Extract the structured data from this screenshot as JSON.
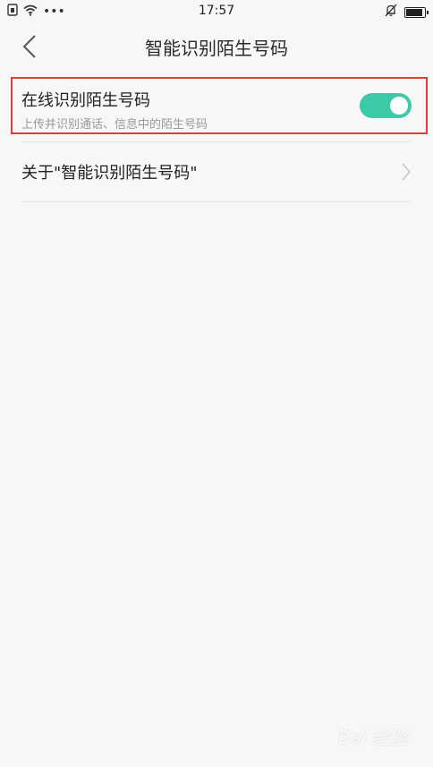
{
  "status_bar": {
    "time": "17:57",
    "left_icons": [
      "sim-icon",
      "wifi-icon",
      "more-dots-icon"
    ],
    "right_icons": [
      "mute-bell-icon",
      "battery-icon"
    ],
    "dots": "•••"
  },
  "nav": {
    "title": "智能识别陌生号码",
    "back_icon": "chevron-left-icon"
  },
  "settings": {
    "online_identify": {
      "title": "在线识别陌生号码",
      "subtitle": "上传并识别通话、信息中的陌生号码",
      "enabled": true
    },
    "about": {
      "title": "关于\"智能识别陌生号码\"",
      "icon": "chevron-right-icon"
    }
  },
  "watermark": {
    "text": "Bai 经验"
  },
  "colors": {
    "toggle_on": "#3cc9a7",
    "highlight": "#e53b3b",
    "background": "#f7f7f7"
  }
}
